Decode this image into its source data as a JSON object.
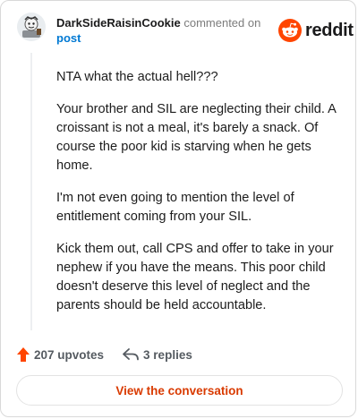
{
  "header": {
    "author": "DarkSideRaisinCookie",
    "action": "commented on",
    "post_link": "post"
  },
  "brand": {
    "logo_text": "reddit",
    "accent_color": "#ff4500"
  },
  "comment": {
    "paragraphs": [
      "NTA what the actual hell???",
      "Your brother and SIL are neglecting their child. A croissant is not a meal, it's barely a snack. Of course the poor kid is starving when he gets home.",
      "I'm not even going to mention the level of entitlement coming from your SIL.",
      "Kick them out, call CPS and offer to take in your nephew if you have the means. This poor child doesn't deserve this level of neglect and the parents should be held accountable."
    ]
  },
  "footer": {
    "upvotes_label": "207 upvotes",
    "replies_label": "3 replies",
    "upvote_color": "#ff4500"
  },
  "cta": {
    "label": "View the conversation",
    "color": "#d93a00"
  }
}
